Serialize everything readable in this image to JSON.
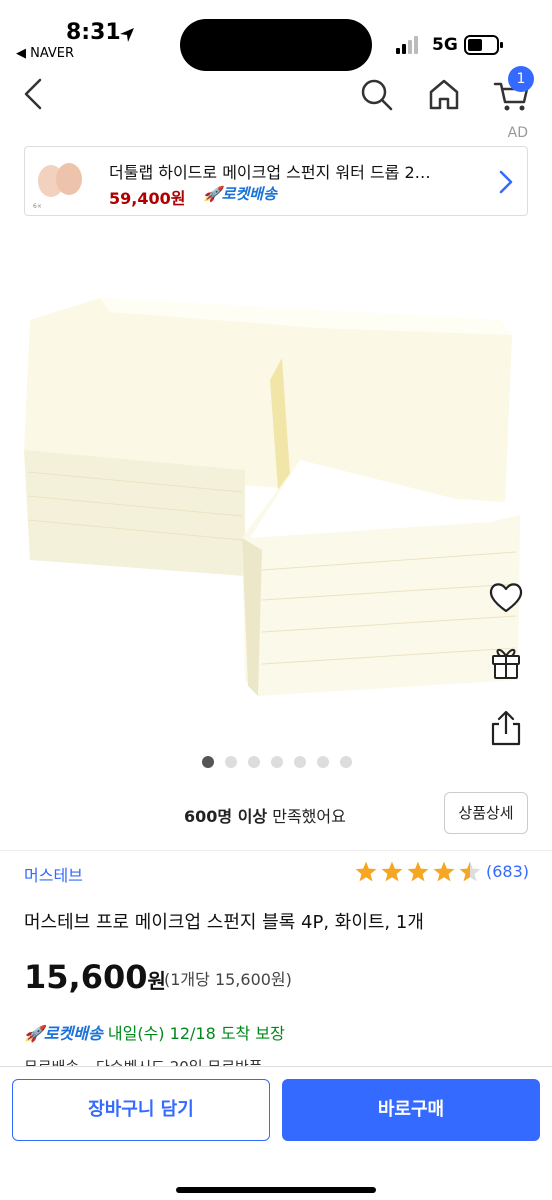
{
  "status_bar": {
    "time": "8:31",
    "back_app": "◀ NAVER",
    "network": "5G"
  },
  "nav": {
    "cart_count": "1"
  },
  "ad": {
    "label": "AD",
    "title": "더툴랩 하이드로 메이크업 스펀지 워터 드롭 2…",
    "price": "59,400원",
    "delivery": "로켓배송"
  },
  "gallery": {
    "total_images": 7,
    "active_index": 0
  },
  "satisfaction": {
    "count_text": "600명 이상",
    "suffix": " 만족했어요",
    "detail_button": "상품상세"
  },
  "product": {
    "brand": "머스테브",
    "rating": 4.5,
    "review_count": "(683)",
    "title": "머스테브 프로 메이크업 스펀지 블록 4P, 화이트, 1개",
    "price": "15,600",
    "price_unit": "원",
    "unit_price": "(1개당 15,600원)"
  },
  "delivery": {
    "type": "로켓배송",
    "eta": "내일(수) 12/18 도착 보장"
  },
  "extra_info": {
    "free_return": "무료배송",
    "card": "다수벤시드 20일 무료반품"
  },
  "bottom_bar": {
    "cart_button": "장바구니 담기",
    "buy_button": "바로구매"
  },
  "colors": {
    "accent": "#346aff",
    "price_red": "#ae0000",
    "rocket_blue": "#1a73d9",
    "eta_green": "#00891a",
    "star": "#f5a623"
  }
}
